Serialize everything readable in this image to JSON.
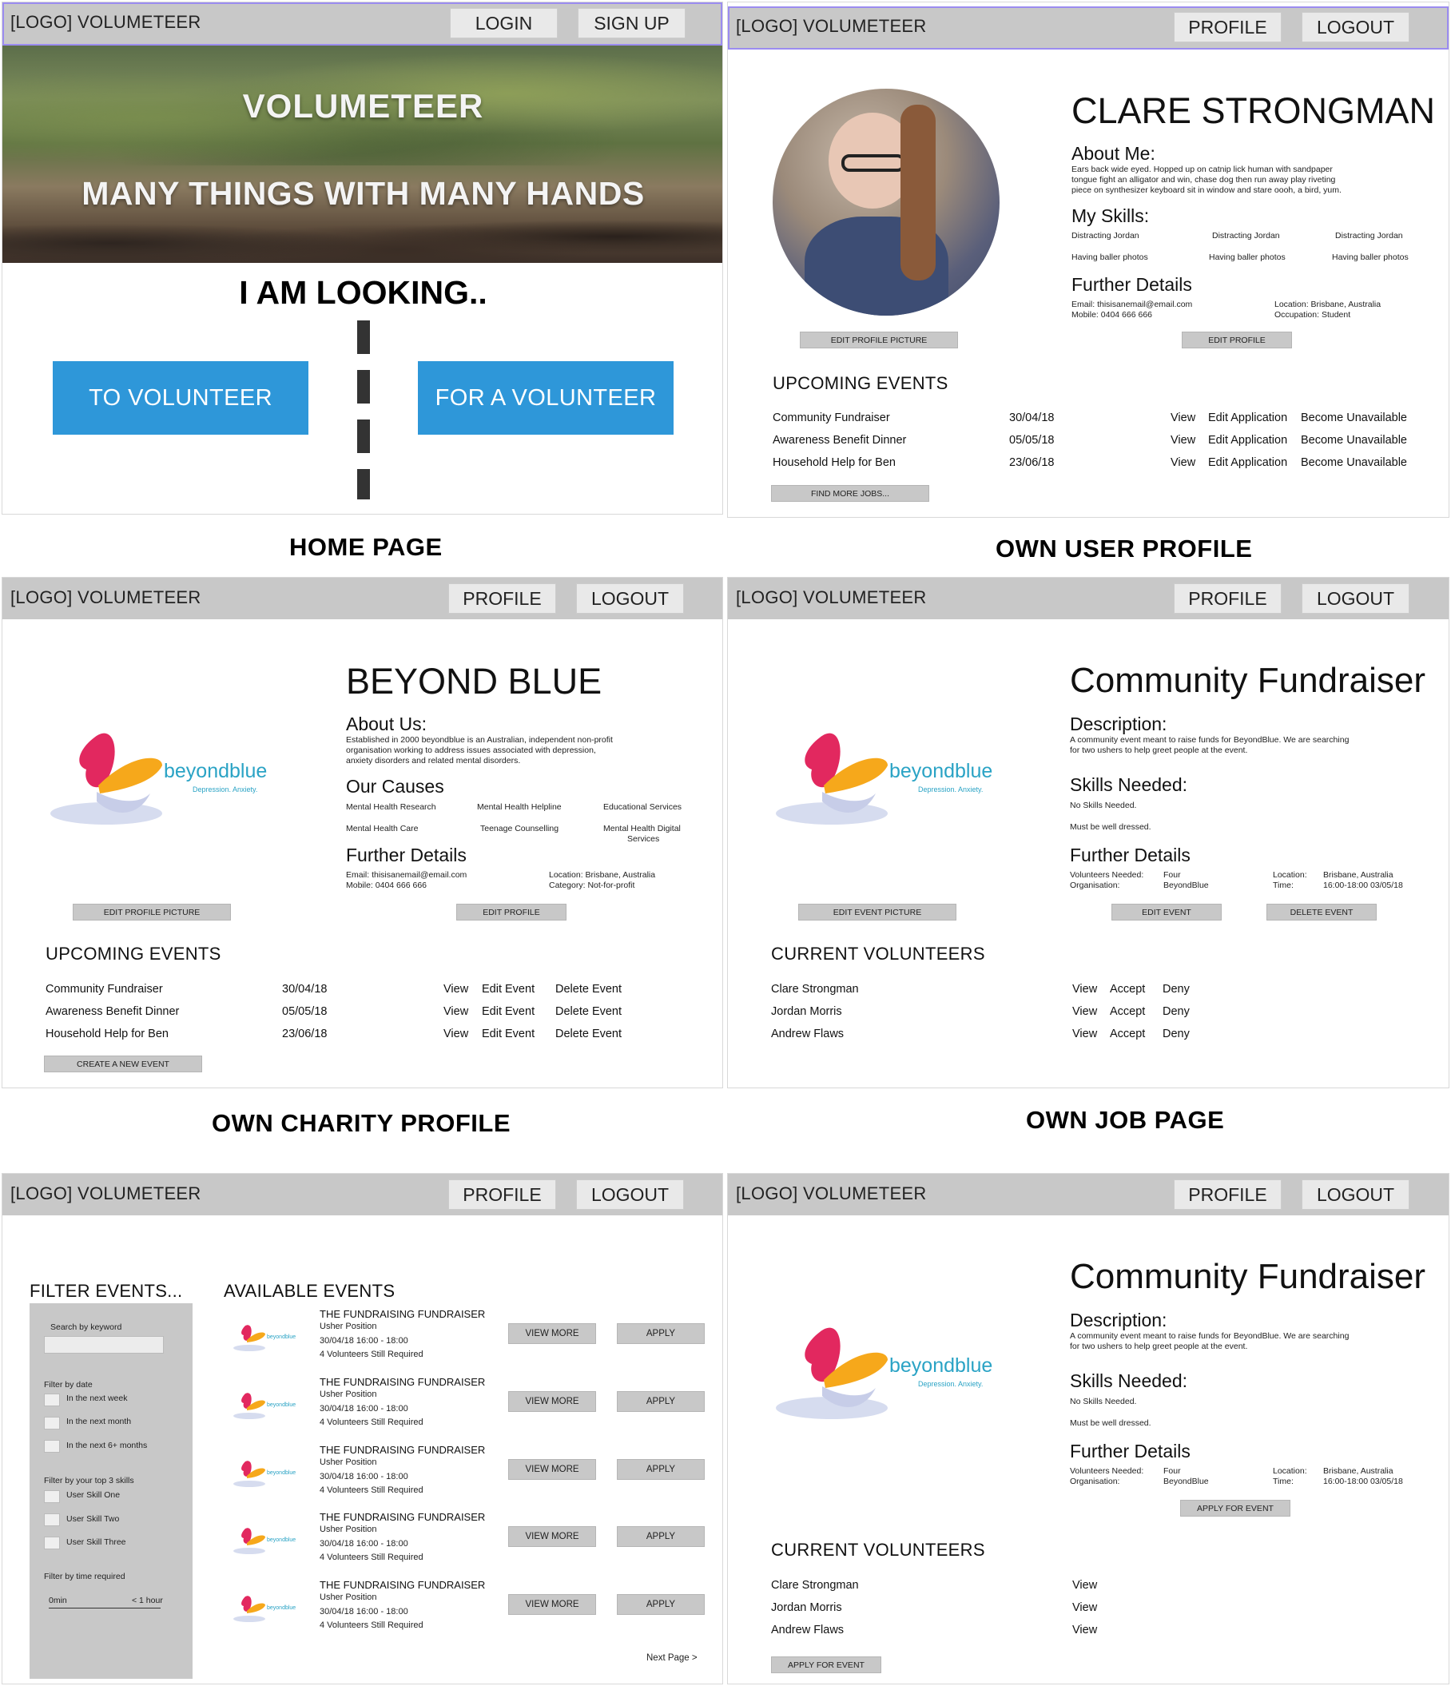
{
  "brand": "[LOGO] VOLUMETEER",
  "captions": {
    "home": "HOME PAGE",
    "user": "OWN USER PROFILE",
    "charity": "OWN CHARITY PROFILE",
    "job": "OWN JOB PAGE"
  },
  "home": {
    "login": "LOGIN",
    "signup": "SIGN UP",
    "hero_title": "VOLUMETEER",
    "hero_tagline": "MANY THINGS WITH MANY HANDS",
    "looking": "I AM LOOKING..",
    "to_volunteer": "TO VOLUNTEER",
    "for_volunteer": "FOR A VOLUNTEER"
  },
  "nav": {
    "profile": "PROFILE",
    "logout": "LOGOUT"
  },
  "user": {
    "name": "CLARE STRONGMAN",
    "about_head": "About Me:",
    "about_text": [
      "Ears back wide eyed. Hopped up on catnip lick human with sandpaper",
      "tongue fight an alligator and win, chase dog then run away play riveting",
      "piece on synthesizer keyboard sit in window and stare oooh, a bird, yum."
    ],
    "skills_head": "My Skills:",
    "skills": [
      "Distracting Jordan",
      "Distracting Jordan",
      "Distracting Jordan",
      "Having baller photos",
      "Having baller photos",
      "Having baller photos"
    ],
    "further_head": "Further Details",
    "email": "Email:  thisisanemail@email.com",
    "mobile": "Mobile: 0404 666 666",
    "location": "Location:    Brisbane, Australia",
    "occupation": "Occupation: Student",
    "edit_pic": "EDIT PROFILE PICTURE",
    "edit_profile": "EDIT PROFILE",
    "events_head": "UPCOMING EVENTS",
    "events": [
      {
        "name": "Community Fundraiser",
        "date": "30/04/18",
        "view": "View",
        "edit": "Edit Application",
        "unavail": "Become Unavailable"
      },
      {
        "name": "Awareness Benefit Dinner",
        "date": "05/05/18",
        "view": "View",
        "edit": "Edit Application",
        "unavail": "Become Unavailable"
      },
      {
        "name": "Household Help for Ben",
        "date": "23/06/18",
        "view": "View",
        "edit": "Edit Application",
        "unavail": "Become Unavailable"
      }
    ],
    "find_more": "FIND MORE JOBS..."
  },
  "logo": {
    "word": "beyondblue",
    "tag": "Depression. Anxiety."
  },
  "charity": {
    "name": "BEYOND BLUE",
    "about_head": "About Us:",
    "about_text": [
      "Established in 2000 beyondblue is an Australian, independent non-profit",
      "organisation working to address issues associated with depression,",
      "anxiety disorders and related mental disorders."
    ],
    "causes_head": "Our Causes",
    "causes": [
      "Mental Health Research",
      "Mental Health Helpline",
      "Educational Services",
      "Mental Health Care",
      "Teenage Counselling",
      "Mental Health Digital",
      "Services"
    ],
    "further_head": "Further Details",
    "email": "Email:  thisisanemail@email.com",
    "mobile": "Mobile: 0404 666 666",
    "location": "Location:    Brisbane, Australia",
    "category": "Category:    Not-for-profit",
    "edit_pic": "EDIT PROFILE PICTURE",
    "edit_profile": "EDIT PROFILE",
    "events_head": "UPCOMING EVENTS",
    "events": [
      {
        "name": "Community Fundraiser",
        "date": "30/04/18",
        "view": "View",
        "edit": "Edit Event",
        "del": "Delete Event"
      },
      {
        "name": "Awareness Benefit Dinner",
        "date": "05/05/18",
        "view": "View",
        "edit": "Edit Event",
        "del": "Delete Event"
      },
      {
        "name": "Household Help for Ben",
        "date": "23/06/18",
        "view": "View",
        "edit": "Edit Event",
        "del": "Delete Event"
      }
    ],
    "create": "CREATE A NEW EVENT"
  },
  "job": {
    "title": "Community Fundraiser",
    "desc_head": "Description:",
    "desc_text": [
      "A community event meant to raise funds for BeyondBlue. We are searching",
      "for two ushers to help greet people at the event."
    ],
    "skills_head": "Skills Needed:",
    "skill1": "No Skills Needed.",
    "skill2": "Must be well dressed.",
    "further_head": "Further Details",
    "vol_needed_label": "Volunteers Needed:",
    "vol_needed": "Four",
    "org_label": "Organisation:",
    "org": "BeyondBlue",
    "loc_label": "Location:",
    "loc": "Brisbane, Australia",
    "time_label": "Time:",
    "time": "16:00-18:00 03/05/18",
    "edit_pic": "EDIT EVENT PICTURE",
    "edit_event": "EDIT EVENT",
    "delete_event": "DELETE EVENT",
    "volunteers_head": "CURRENT VOLUNTEERS",
    "volunteers": [
      {
        "name": "Clare Strongman",
        "view": "View",
        "accept": "Accept",
        "deny": "Deny"
      },
      {
        "name": "Jordan Morris",
        "view": "View",
        "accept": "Accept",
        "deny": "Deny"
      },
      {
        "name": "Andrew Flaws",
        "view": "View",
        "accept": "Accept",
        "deny": "Deny"
      }
    ],
    "apply": "APPLY FOR EVENT"
  },
  "search": {
    "filter_head": "FILTER EVENTS...",
    "available_head": "AVAILABLE EVENTS",
    "keyword_label": "Search by keyword",
    "date_label": "Filter by date",
    "date_opts": [
      "In the next week",
      "In the next month",
      "In the next 6+ months"
    ],
    "skills_label": "Filter by your top 3 skills",
    "skill_opts": [
      "User Skill One",
      "User Skill Two",
      "User Skill Three"
    ],
    "time_label": "Filter by time required",
    "time_min": "0min",
    "time_max": "< 1 hour",
    "events": [
      {
        "title": "THE FUNDRAISING FUNDRAISER",
        "pos": "Usher Position",
        "when": "30/04/18 16:00 - 18:00",
        "need": "4 Volunteers Still Required",
        "view": "VIEW MORE",
        "apply": "APPLY"
      },
      {
        "title": "THE FUNDRAISING FUNDRAISER",
        "pos": "Usher Position",
        "when": "30/04/18 16:00 - 18:00",
        "need": "4 Volunteers Still Required",
        "view": "VIEW MORE",
        "apply": "APPLY"
      },
      {
        "title": "THE FUNDRAISING FUNDRAISER",
        "pos": "Usher Position",
        "when": "30/04/18 16:00 - 18:00",
        "need": "4 Volunteers Still Required",
        "view": "VIEW MORE",
        "apply": "APPLY"
      },
      {
        "title": "THE FUNDRAISING FUNDRAISER",
        "pos": "Usher Position",
        "when": "30/04/18 16:00 - 18:00",
        "need": "4 Volunteers Still Required",
        "view": "VIEW MORE",
        "apply": "APPLY"
      },
      {
        "title": "THE FUNDRAISING FUNDRAISER",
        "pos": "Usher Position",
        "when": "30/04/18 16:00 - 18:00",
        "need": "4 Volunteers Still Required",
        "view": "VIEW MORE",
        "apply": "APPLY"
      }
    ],
    "next": "Next Page >"
  },
  "job_public": {
    "volunteers": [
      {
        "name": "Clare Strongman",
        "view": "View"
      },
      {
        "name": "Jordan Morris",
        "view": "View"
      },
      {
        "name": "Andrew Flaws",
        "view": "View"
      }
    ]
  }
}
